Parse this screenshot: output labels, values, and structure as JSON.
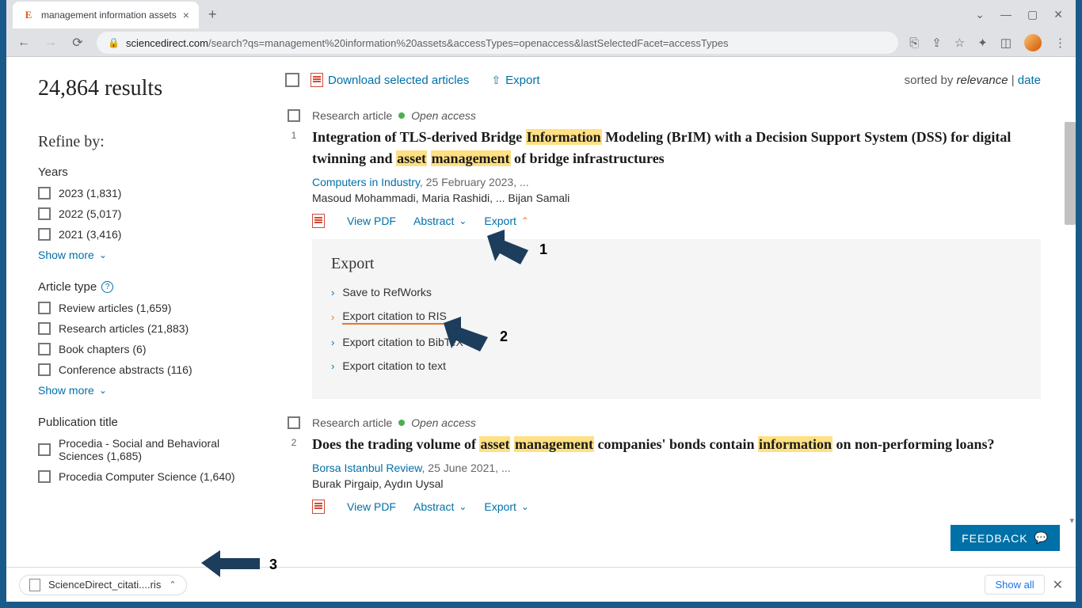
{
  "browser": {
    "tab_title": "management information assets",
    "url_domain": "sciencedirect.com",
    "url_path": "/search?qs=management%20information%20assets&accessTypes=openaccess&lastSelectedFacet=accessTypes",
    "download_file": "ScienceDirect_citati....ris",
    "show_all": "Show all"
  },
  "results_count": "24,864 results",
  "refine_heading": "Refine by:",
  "facets": {
    "years": {
      "title": "Years",
      "items": [
        {
          "label": "2023 (1,831)"
        },
        {
          "label": "2022 (5,017)"
        },
        {
          "label": "2021 (3,416)"
        }
      ],
      "show_more": "Show more"
    },
    "article_type": {
      "title": "Article type",
      "items": [
        {
          "label": "Review articles (1,659)"
        },
        {
          "label": "Research articles (21,883)"
        },
        {
          "label": "Book chapters (6)"
        },
        {
          "label": "Conference abstracts (116)"
        }
      ],
      "show_more": "Show more"
    },
    "pub_title": {
      "title": "Publication title",
      "items": [
        {
          "label": "Procedia - Social and Behavioral Sciences (1,685)"
        },
        {
          "label": "Procedia Computer Science (1,640)"
        }
      ]
    }
  },
  "toolbar": {
    "download_selected": "Download selected articles",
    "export": "Export",
    "sorted_by": "sorted by",
    "relevance": "relevance",
    "date": "date"
  },
  "results": [
    {
      "num": "1",
      "type": "Research article",
      "oa": "Open access",
      "title_parts": [
        "Integration of TLS-derived Bridge ",
        "Information",
        " Modeling (BrIM) with a Decision Support System (DSS) for digital twinning and ",
        "asset",
        " ",
        "management",
        " of bridge infrastructures"
      ],
      "src_journal": "Computers in Industry",
      "src_date": ", 25 February 2023, ...",
      "authors": "Masoud Mohammadi, Maria Rashidi, ... Bijan Samali",
      "view_pdf": "View PDF",
      "abstract": "Abstract",
      "export": "Export"
    },
    {
      "num": "2",
      "type": "Research article",
      "oa": "Open access",
      "title_parts": [
        "Does the trading volume of ",
        "asset",
        " ",
        "management",
        " companies' bonds contain ",
        "information",
        " on non-performing loans?"
      ],
      "src_journal": "Borsa Istanbul Review",
      "src_date": ", 25 June 2021, ...",
      "authors": "Burak Pirgaip, Aydın Uysal",
      "view_pdf": "View PDF",
      "abstract": "Abstract",
      "export": "Export"
    }
  ],
  "export_panel": {
    "title": "Export",
    "options": [
      "Save to RefWorks",
      "Export citation to RIS",
      "Export citation to BibTeX",
      "Export citation to text"
    ]
  },
  "feedback": "FEEDBACK",
  "annotations": {
    "a1": "1",
    "a2": "2",
    "a3": "3"
  }
}
